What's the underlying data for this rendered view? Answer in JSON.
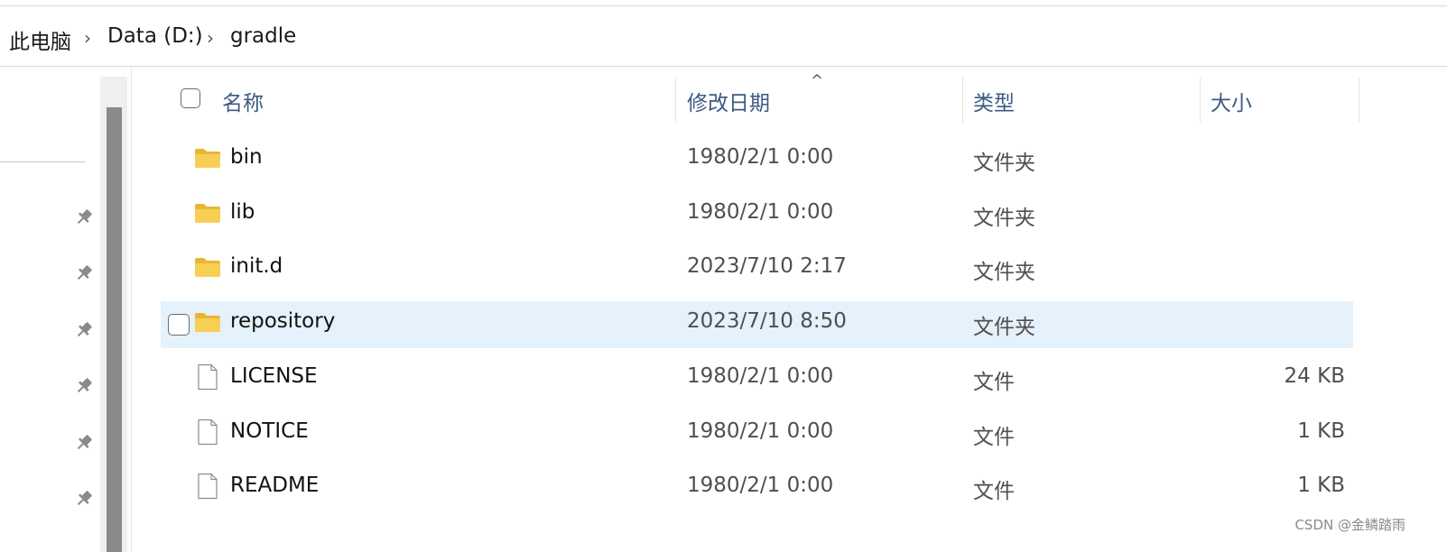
{
  "breadcrumb": {
    "items": [
      "此电脑",
      "Data (D:)",
      "gradle"
    ]
  },
  "columns": {
    "name": "名称",
    "modified": "修改日期",
    "type": "类型",
    "size": "大小",
    "sort_indicator": "^"
  },
  "files": [
    {
      "name": "bin",
      "modified": "1980/2/1 0:00",
      "type": "文件夹",
      "size": "",
      "icon": "folder-icon"
    },
    {
      "name": "lib",
      "modified": "1980/2/1 0:00",
      "type": "文件夹",
      "size": "",
      "icon": "folder-icon"
    },
    {
      "name": "init.d",
      "modified": "2023/7/10 2:17",
      "type": "文件夹",
      "size": "",
      "icon": "folder-icon"
    },
    {
      "name": "repository",
      "modified": "2023/7/10 8:50",
      "type": "文件夹",
      "size": "",
      "icon": "folder-icon",
      "selected": true
    },
    {
      "name": "LICENSE",
      "modified": "1980/2/1 0:00",
      "type": "文件",
      "size": "24 KB",
      "icon": "file-icon"
    },
    {
      "name": "NOTICE",
      "modified": "1980/2/1 0:00",
      "type": "文件",
      "size": "1 KB",
      "icon": "file-icon"
    },
    {
      "name": "README",
      "modified": "1980/2/1 0:00",
      "type": "文件",
      "size": "1 KB",
      "icon": "file-icon"
    }
  ],
  "watermark": "CSDN @金鳞踏雨",
  "colors": {
    "header_text": "#3c5a84",
    "selected_row": "#e5f1fb",
    "folder_yellow": "#f5c542"
  }
}
